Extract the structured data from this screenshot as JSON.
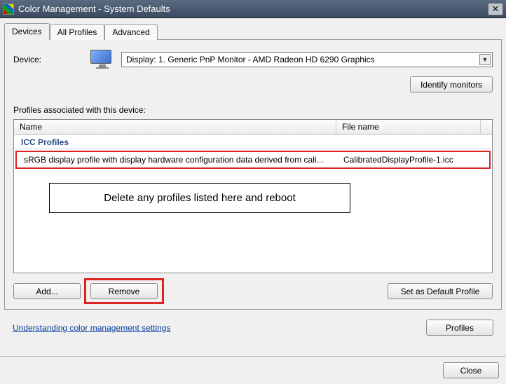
{
  "window": {
    "title": "Color Management - System Defaults"
  },
  "tabs": {
    "devices": "Devices",
    "all_profiles": "All Profiles",
    "advanced": "Advanced"
  },
  "device": {
    "label": "Device:",
    "selected": "Display: 1. Generic PnP Monitor - AMD Radeon HD 6290 Graphics",
    "identify_btn": "Identify monitors"
  },
  "profiles": {
    "section_label": "Profiles associated with this device:",
    "columns": {
      "name": "Name",
      "file": "File name"
    },
    "group_label": "ICC Profiles",
    "rows": [
      {
        "name": "sRGB display profile with display hardware configuration data derived from cali...",
        "file": "CalibratedDisplayProfile-1.icc"
      }
    ]
  },
  "annotation": "Delete any profiles listed here and reboot",
  "buttons": {
    "add": "Add...",
    "remove": "Remove",
    "set_default": "Set as Default Profile",
    "profiles": "Profiles",
    "close": "Close"
  },
  "link": "Understanding color management settings"
}
